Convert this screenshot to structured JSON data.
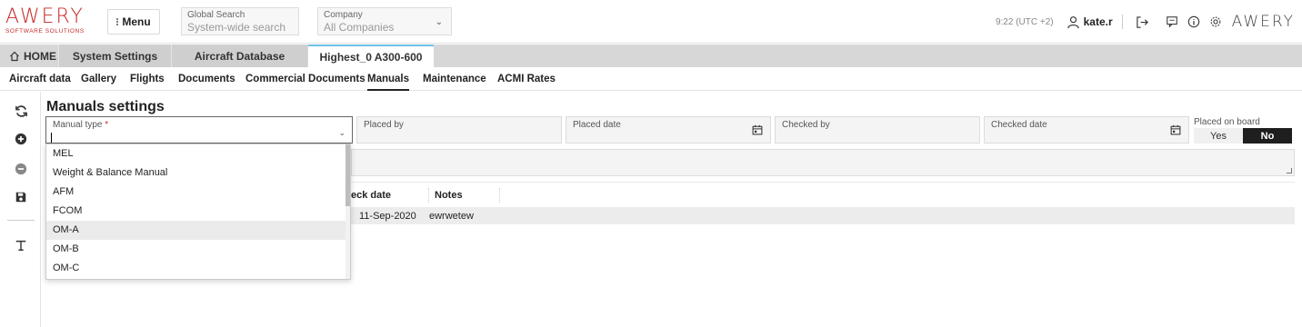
{
  "header": {
    "logo_word": "AWERY",
    "logo_sub": "SOFTWARE SOLUTIONS",
    "menu_label": "Menu",
    "global_search": {
      "label": "Global Search",
      "placeholder": "System-wide search"
    },
    "company": {
      "label": "Company",
      "value": "All Companies"
    },
    "time": "9:22 (UTC +2)",
    "user": "kate.r",
    "brand": "AWERY"
  },
  "tabs": {
    "home": "HOME",
    "system_settings": "System Settings",
    "aircraft_database": "Aircraft Database",
    "active": "Highest_0 A300-600"
  },
  "subnav": {
    "items": [
      "Aircraft data",
      "Gallery",
      "Flights",
      "Documents",
      "Commercial Documents",
      "Manuals",
      "Maintenance",
      "ACMI Rates"
    ],
    "active": "Manuals"
  },
  "page": {
    "title": "Manuals settings"
  },
  "form": {
    "manual_type_label": "Manual type",
    "required_mark": "*",
    "placed_by_label": "Placed by",
    "placed_date_label": "Placed date",
    "checked_by_label": "Checked by",
    "checked_date_label": "Checked date",
    "placed_on_board_label": "Placed on board",
    "yes_label": "Yes",
    "no_label": "No"
  },
  "dropdown": {
    "options": [
      "MEL",
      "Weight & Balance Manual",
      "AFM",
      "FCOM",
      "OM-A",
      "OM-B",
      "OM-C"
    ],
    "highlighted": "OM-A"
  },
  "grid": {
    "columns": [
      "eck date",
      "Notes"
    ],
    "rows": [
      {
        "check_date": "11-Sep-2020",
        "notes": "ewrwetew"
      }
    ]
  }
}
